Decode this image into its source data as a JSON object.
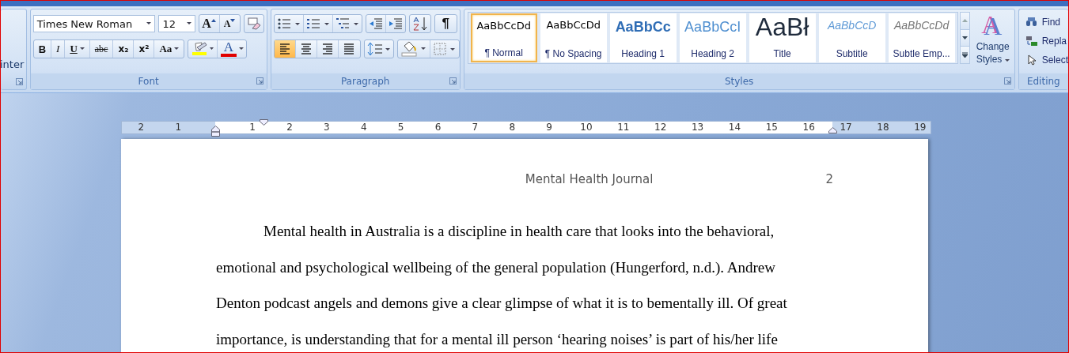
{
  "clipboard": {
    "partial_label": "inter"
  },
  "font": {
    "group_label": "Font",
    "font_name": "Times New Roman",
    "font_size": "12",
    "size_buttons": [
      {
        "kind": "grow",
        "glyph": "A"
      },
      {
        "kind": "shrink",
        "glyph": "A"
      }
    ],
    "format_buttons": [
      {
        "kind": "bold",
        "glyph": "B",
        "dropdown": false
      },
      {
        "kind": "italic",
        "glyph": "I",
        "dropdown": false
      },
      {
        "kind": "underline",
        "glyph": "U",
        "dropdown": true
      },
      {
        "kind": "strike",
        "glyph": "abc",
        "dropdown": false
      },
      {
        "kind": "sub",
        "glyph": "x₂",
        "dropdown": false
      },
      {
        "kind": "super",
        "glyph": "x²",
        "dropdown": false
      },
      {
        "kind": "case",
        "glyph": "Aa",
        "dropdown": true
      }
    ],
    "color_glyph": "A"
  },
  "paragraph": {
    "group_label": "Paragraph",
    "show_marks_glyph": "¶",
    "alignments": [
      {
        "kind": "left",
        "selected": true
      },
      {
        "kind": "center",
        "selected": false
      },
      {
        "kind": "right",
        "selected": false
      },
      {
        "kind": "justify",
        "selected": false
      }
    ]
  },
  "styles": {
    "group_label": "Styles",
    "items": [
      {
        "kind": "normal",
        "preview": "AaBbCcDd",
        "label": "¶ Normal",
        "selected": true
      },
      {
        "kind": "nospacing",
        "preview": "AaBbCcDd",
        "label": "¶ No Spacing",
        "selected": false
      },
      {
        "kind": "heading1",
        "preview": "AaBbCc",
        "label": "Heading 1",
        "selected": false
      },
      {
        "kind": "heading2",
        "preview": "AaBbCcI",
        "label": "Heading 2",
        "selected": false
      },
      {
        "kind": "title",
        "preview": "AaBł",
        "label": "Title",
        "selected": false
      },
      {
        "kind": "subtitle",
        "preview": "AaBbCcD",
        "label": "Subtitle",
        "selected": false
      },
      {
        "kind": "subtle",
        "preview": "AaBbCcDd",
        "label": "Subtle Emp...",
        "selected": false
      }
    ],
    "change_glyph": "A",
    "change_label_1": "Change",
    "change_label_2": "Styles"
  },
  "editing": {
    "group_label": "Editing",
    "items": [
      {
        "kind": "find",
        "label": "Find"
      },
      {
        "kind": "replace",
        "label": "Repla"
      },
      {
        "kind": "select",
        "label": "Select"
      }
    ]
  },
  "ruler": {
    "left_numbers": [
      "2",
      "1"
    ],
    "numbers": [
      "1",
      "2",
      "3",
      "4",
      "5",
      "6",
      "7",
      "8",
      "9",
      "10",
      "11",
      "12",
      "13",
      "14",
      "15",
      "16",
      "17",
      "18",
      "19"
    ]
  },
  "document": {
    "header": "Mental Health Journal",
    "page_number": "2",
    "lines": [
      "Mental health in Australia is a discipline in health care that looks into the behavioral,",
      "emotional and psychological wellbeing of the general population (Hungerford, n.d.). Andrew",
      "Denton podcast angels and demons give a clear glimpse of what it is to bementally ill. Of great",
      "importance, is understanding that for a mental ill person ‘hearing noises’ is part of his/her life"
    ]
  }
}
